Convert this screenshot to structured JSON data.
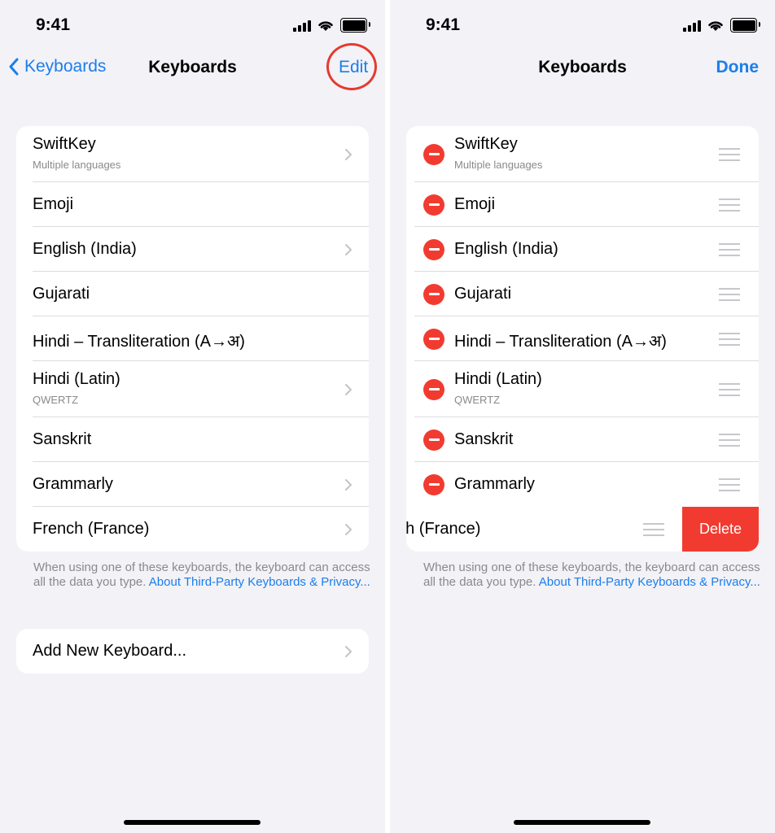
{
  "status": {
    "time": "9:41"
  },
  "left": {
    "back_label": "Keyboards",
    "title": "Keyboards",
    "action_label": "Edit",
    "keyboards": [
      {
        "name": "SwiftKey",
        "sub": "Multiple languages"
      },
      {
        "name": "Emoji"
      },
      {
        "name": "English (India)"
      },
      {
        "name": "Gujarati"
      },
      {
        "name": "Hindi – Transliteration (A→अ)"
      },
      {
        "name": "Hindi (Latin)",
        "sub": "QWERTZ"
      },
      {
        "name": "Sanskrit"
      },
      {
        "name": "Grammarly"
      },
      {
        "name": "French (France)"
      }
    ],
    "footer_text": "When using one of these keyboards, the keyboard can access all the data you type. ",
    "footer_link": "About Third-Party Keyboards & Privacy...",
    "add_keyboard_label": "Add New Keyboard..."
  },
  "right": {
    "title": "Keyboards",
    "action_label": "Done",
    "keyboards": [
      {
        "name": "SwiftKey",
        "sub": "Multiple languages"
      },
      {
        "name": "Emoji"
      },
      {
        "name": "English (India)"
      },
      {
        "name": "Gujarati"
      },
      {
        "name": "Hindi – Transliteration (A→अ)"
      },
      {
        "name": "Hindi (Latin)",
        "sub": "QWERTZ"
      },
      {
        "name": "Sanskrit"
      },
      {
        "name": "Grammarly"
      }
    ],
    "swiped_row_text": "nch (France)",
    "delete_label": "Delete",
    "footer_text": "When using one of these keyboards, the keyboard can access all the data you type. ",
    "footer_link": "About Third-Party Keyboards & Privacy..."
  },
  "colors": {
    "accent": "#1c7eea",
    "destructive": "#f23b30",
    "background": "#f2f2f7"
  }
}
